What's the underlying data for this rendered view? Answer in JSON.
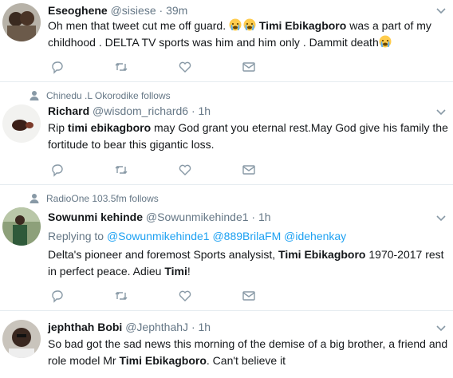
{
  "tweets": [
    {
      "name": "Eseoghene",
      "handle": "@sisiese",
      "time": "39m",
      "text_a": "Oh men that tweet cut me off guard. ",
      "bold_name": "Timi Ebikagboro",
      "text_b": " was a part of my childhood . DELTA TV sports was him and him only   . Dammit death",
      "emoji": "crying-face"
    },
    {
      "follows": "Chinedu .L Okorodike follows",
      "name": "Richard",
      "handle": "@wisdom_richard6",
      "time": "1h",
      "text_a": "Rip ",
      "bold_name": "timi ebikagboro",
      "text_b": " may God grant you eternal rest.May God give his family the fortitude to bear this gigantic loss."
    },
    {
      "follows": "RadioOne 103.5fm follows",
      "name": "Sowunmi kehinde",
      "handle": "@Sowunmikehinde1",
      "time": "1h",
      "replying_label": "Replying to ",
      "mentions": [
        "@Sowunmikehinde1",
        "@889BrilaFM",
        "@idehenkay"
      ],
      "text_a": "Delta's pioneer and foremost Sports analysist, ",
      "bold_name": "Timi Ebikagboro",
      "text_b": " 1970-2017 rest in perfect peace. Adieu ",
      "bold_name2": "Timi",
      "text_c": "!"
    },
    {
      "name": "jephthah Bobi",
      "handle": "@JephthahJ",
      "time": "1h",
      "text_a": "So bad got the sad news this morning of the demise of a big brother, a friend and role model Mr ",
      "bold_name": "Timi Ebikagboro",
      "text_b": ". Can't believe it"
    }
  ],
  "separator": "·",
  "colors": {
    "link": "#1da1f2",
    "muted": "#657786",
    "text": "#14171a",
    "border": "#e6ecf0"
  }
}
